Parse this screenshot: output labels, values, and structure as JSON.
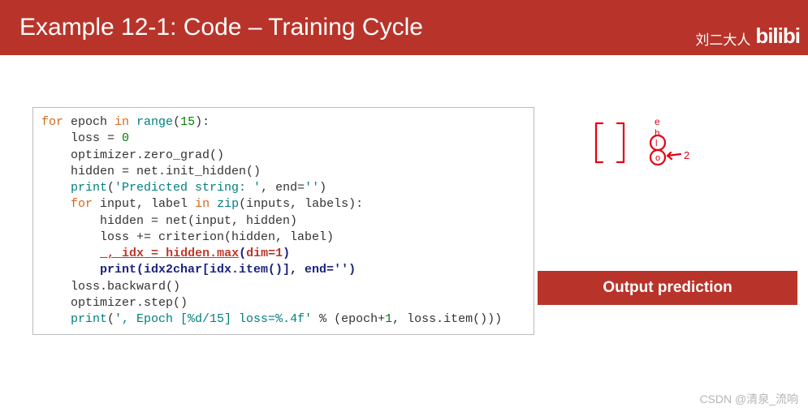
{
  "header": {
    "title": "Example 12-1: Code – Training Cycle",
    "author": "刘二大人",
    "logo": "bilibi"
  },
  "code": {
    "l1_for": "for",
    "l1_epoch": " epoch ",
    "l1_in": "in",
    "l1_range": " range",
    "l1_open": "(",
    "l1_num": "15",
    "l1_close": "):",
    "l2": "    loss = ",
    "l2_num": "0",
    "l3": "    optimizer.zero_grad()",
    "l4": "    hidden = net.init_hidden()",
    "l5_print": "    print",
    "l5_open": "(",
    "l5_str1": "'Predicted string: '",
    "l5_mid": ", end=",
    "l5_str2": "''",
    "l5_close": ")",
    "l6_indent": "    ",
    "l6_for": "for",
    "l6_mid": " input, label ",
    "l6_in": "in",
    "l6_zip": " zip",
    "l6_args": "(inputs, labels):",
    "l7": "        hidden = net(input, hidden)",
    "l8": "        loss += criterion(hidden, label)",
    "l9_indent": "        ",
    "l9_a": "_, ",
    "l9_idx": "idx",
    "l9_eq": " = ",
    "l9_hm": "hidden.max",
    "l9_open": "(",
    "l9_dim": "dim=1",
    "l9_close": ")",
    "l10_indent": "        ",
    "l10_print": "print(idx2char[idx.item()], end='')",
    "l11": "    loss.backward()",
    "l12": "    optimizer.step()",
    "l13_print": "    print",
    "l13_open": "(",
    "l13_str": "', Epoch [%d/15] loss=%.4f'",
    "l13_mid": " % (epoch+",
    "l13_one": "1",
    "l13_end": ", loss.item()))"
  },
  "callout": {
    "label": "Output prediction"
  },
  "watermark": "CSDN @清泉_流响",
  "annotation": {
    "labels": [
      "e",
      "h",
      "l",
      "o",
      "2"
    ]
  }
}
